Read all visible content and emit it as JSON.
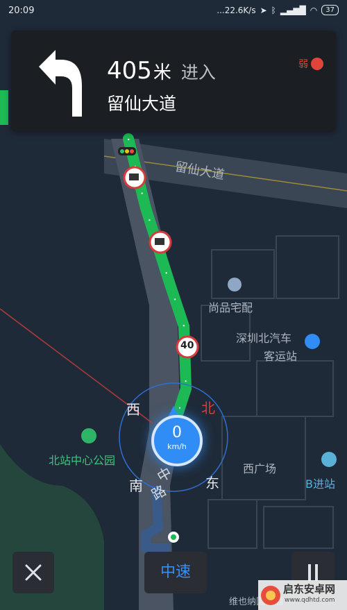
{
  "status": {
    "time": "20:09",
    "net_speed": "...22.6K/s",
    "battery": "37"
  },
  "nav": {
    "distance_value": "405",
    "distance_unit": "米",
    "action": "进入",
    "road": "留仙大道",
    "gps_signal": "弱"
  },
  "map": {
    "road_label": "留仙大道",
    "poi_1": "尚品宅配",
    "poi_2_line1": "深圳北汽车",
    "poi_2_line2": "客运站",
    "poi_3": "北站中心公园",
    "poi_4": "西广场",
    "poi_5": "B进站",
    "poi_6": "维也纳国际酒",
    "road_vertical_1": "中",
    "road_vertical_2": "路",
    "speed_limit": "40"
  },
  "compass": {
    "north": "北",
    "south": "南",
    "east": "东",
    "west": "西"
  },
  "speedometer": {
    "value": "0",
    "unit": "km/h"
  },
  "controls": {
    "speed_mode": "中速"
  },
  "watermark": {
    "name": "启东安卓网",
    "url": "www.qdhtd.com"
  },
  "colors": {
    "route": "#1db954",
    "accent": "#2f8df5",
    "card_bg": "#1b1e23",
    "gps_weak": "#e0453b"
  }
}
